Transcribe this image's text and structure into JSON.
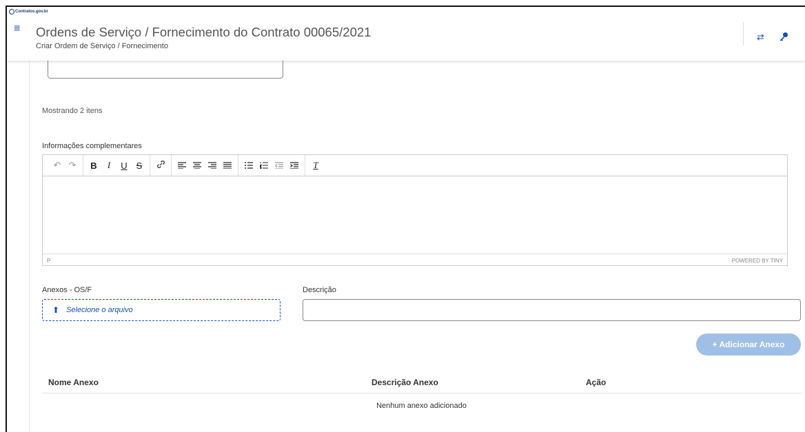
{
  "header": {
    "logo_text": "Contratos.gov.br",
    "title": "Ordens de Serviço / Fornecimento do Contrato 00065/2021",
    "subtitle": "Criar Ordem de Serviço / Fornecimento",
    "menu_icon": "hamburger-icon",
    "icons": [
      "swap-icon",
      "key-icon"
    ]
  },
  "list": {
    "showing_text": "Mostrando 2 itens"
  },
  "editor": {
    "label": "Informações complementares",
    "status_path": "P",
    "powered_by": "POWERED BY TINY",
    "toolbar_groups": [
      [
        "undo-icon",
        "redo-icon"
      ],
      [
        "bold-icon",
        "italic-icon",
        "underline-icon",
        "strikethrough-icon"
      ],
      [
        "link-icon"
      ],
      [
        "align-left-icon",
        "align-center-icon",
        "align-right-icon",
        "align-justify-icon"
      ],
      [
        "bullet-list-icon",
        "numbered-list-icon",
        "outdent-icon",
        "indent-icon"
      ],
      [
        "clear-formatting-icon"
      ]
    ]
  },
  "attachments": {
    "label": "Anexos - OS/F",
    "file_button_label": "Selecione o arquivo",
    "description_label": "Descrição",
    "description_value": "",
    "add_button_label": "+ Adicionar Anexo"
  },
  "table": {
    "columns": [
      "Nome Anexo",
      "Descrição Anexo",
      "Ação"
    ],
    "empty_text": "Nenhum anexo adicionado"
  },
  "colors": {
    "primary": "#1351b4",
    "add_button": "#9fbfe6"
  }
}
